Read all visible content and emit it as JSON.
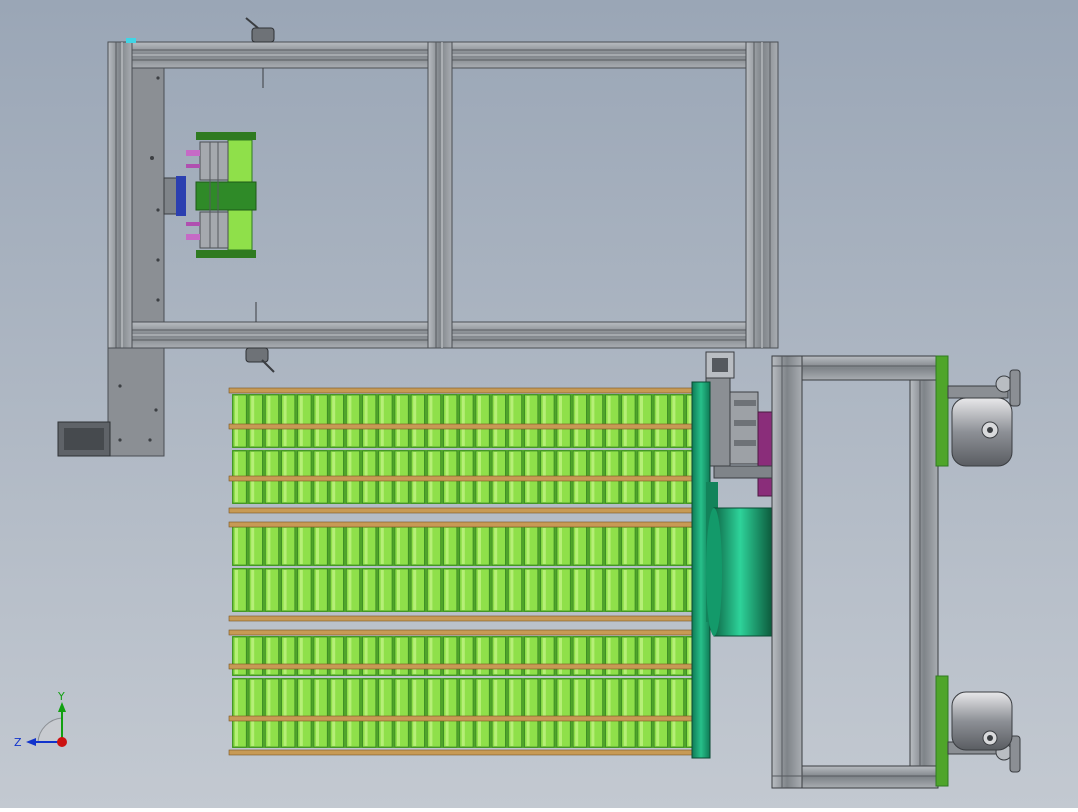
{
  "viewport": {
    "background_top": "#9aa6b6",
    "background_bottom": "#c3c9d1"
  },
  "colors": {
    "frame_gray": "#8e9399",
    "frame_dark": "#55595e",
    "plate_gray": "#8b8f94",
    "green_light": "#8fe04a",
    "green_mid": "#4fa52a",
    "green_dark": "#2f7a20",
    "teal": "#1fa77a",
    "teal_dark": "#0f6a4a",
    "rod_copper": "#c79a55",
    "purple": "#8a2d7a",
    "magenta": "#b04fb0",
    "axis_y": "#11a011",
    "axis_z": "#1133cc",
    "axis_origin": "#cc1111"
  },
  "triad": {
    "y_label": "Y",
    "z_label": "Z"
  }
}
